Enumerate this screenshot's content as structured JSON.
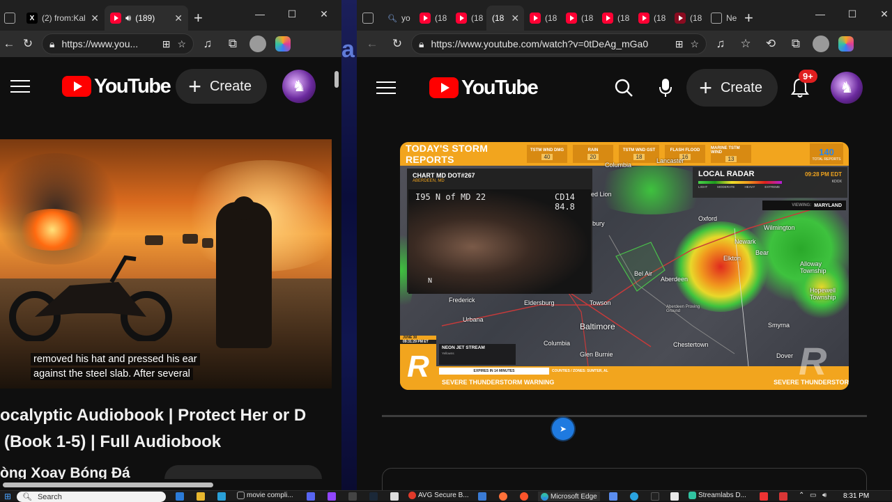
{
  "left_window": {
    "tabs": [
      {
        "label": "",
        "icon": "window-icon"
      },
      {
        "label": "(2) from:Kal",
        "icon": "x-logo-icon"
      },
      {
        "label": "(189)",
        "icon": "youtube-icon"
      }
    ],
    "url": "https://www.you...",
    "youtube": {
      "logo_text": "YouTube",
      "create_label": "Create",
      "caption_line1": "removed his hat and pressed his ear",
      "caption_line2": "against the steel slab. After several",
      "title_line1": "ocalyptic Audiobook | Protect Her or D",
      "title_line2": "(Book 1-5) | Full Audiobook",
      "channel": "òng Xoay Bóng Đá"
    }
  },
  "right_window": {
    "tabs": [
      {
        "label": "yo",
        "icon": "search-icon"
      },
      {
        "label": "(18",
        "icon": "youtube-icon"
      },
      {
        "label": "(18",
        "icon": "youtube-icon"
      },
      {
        "label": "(18",
        "icon": "youtube-icon"
      },
      {
        "label": "(18",
        "icon": "youtube-icon"
      },
      {
        "label": "(18",
        "icon": "youtube-icon"
      },
      {
        "label": "(18",
        "icon": "youtube-icon"
      },
      {
        "label": "(18",
        "icon": "youtube-icon"
      },
      {
        "label": "(18",
        "icon": "youtube-icon"
      },
      {
        "label": "Ne",
        "icon": "new-tab-icon"
      }
    ],
    "url": "https://www.youtube.com/watch?v=0tDeAg_mGa0",
    "youtube": {
      "logo_text": "YouTube",
      "create_label": "Create",
      "notification_badge": "9+"
    },
    "video": {
      "header_title": "TODAY'S STORM REPORTS",
      "stats": [
        {
          "label": "TSTM WND DMG",
          "value": "40"
        },
        {
          "label": "RAIN",
          "value": "20"
        },
        {
          "label": "TSTM WND GST",
          "value": "18"
        },
        {
          "label": "FLASH FLOOD",
          "value": "16"
        },
        {
          "label": "MARINE TSTM WIND",
          "value": "13"
        }
      ],
      "total_value": "140",
      "total_label": "TOTAL REPORTS",
      "cam_title": "CHART MD DOT#267",
      "cam_location": "ABERDEEN, MD",
      "cam_overlay": "I95 N of MD 22",
      "cam_code": "CD14",
      "cam_num": "84.8",
      "cam_dir": "N",
      "radar_title": "LOCAL RADAR",
      "radar_time": "09:28 PM EDT",
      "radar_station": "KDOX",
      "radar_scale": [
        "LIGHT",
        "MODERATE",
        "HEAVY",
        "EXTREME"
      ],
      "viewing_label": "VIEWING:",
      "viewing_value": "MARYLAND",
      "cities": [
        "Columbia",
        "Lancaster",
        "ed Lion",
        "bury",
        "Oxford",
        "Wilmington",
        "Newark",
        "Bear",
        "Elkton",
        "Alloway Township",
        "Bel Air",
        "Aberdeen",
        "Hopewell Township",
        "Frederick",
        "Eldersburg",
        "Towson",
        "Aberdeen Proving Ground",
        "Urbana",
        "Baltimore",
        "Smyrna",
        "Columbia",
        "Chestertown",
        "Glen Burnie",
        "Dover"
      ],
      "date": "JUNE 30",
      "time": "09:31:29 PM ET",
      "neon_title": "NEON JET STREAM",
      "neon_sub": "Yellowns",
      "expires": "EXPIRES IN 14 MINUTES",
      "counties": "COUNTIES / ZONES: SUMTER, AL",
      "warning": "SEVERE THUNDERSTORM WARNING",
      "warning_right": "SEVERE THUNDERSTOR"
    }
  },
  "desktop_bg_text": "a",
  "taskbar": {
    "search_placeholder": "Search",
    "items": [
      "movie compli...",
      "AVG Secure B...",
      "Microsoft Edge",
      "Streamlabs D..."
    ],
    "time": "8:31 PM"
  },
  "colors": {
    "youtube_red": "#ff0000",
    "storm_orange": "#f2a51e",
    "edge_bg": "#202020"
  }
}
